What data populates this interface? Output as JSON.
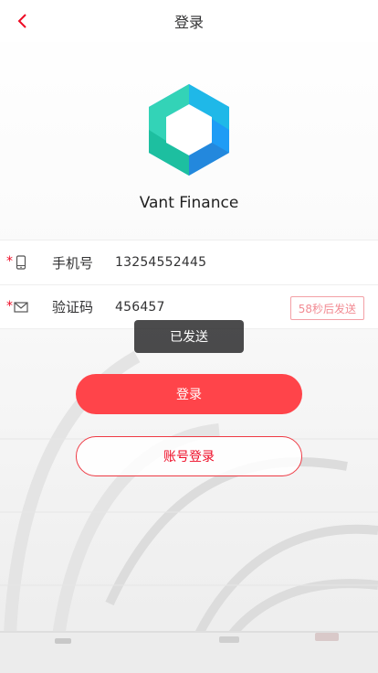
{
  "header": {
    "title": "登录",
    "back_icon": "chevron-left-icon"
  },
  "app": {
    "name": "Vant Finance"
  },
  "form": {
    "required_mark": "*",
    "phone": {
      "icon": "phone-icon",
      "label": "手机号",
      "value": "13254552445"
    },
    "code": {
      "icon": "mail-icon",
      "label": "验证码",
      "value": "456457",
      "send_button": "58秒后发送"
    }
  },
  "toast": {
    "text": "已发送"
  },
  "buttons": {
    "login": "登录",
    "account_login": "账号登录"
  },
  "colors": {
    "brand_red": "#ff444a",
    "logo_teal": "#33d3b7",
    "logo_blue": "#1e9cf5"
  }
}
